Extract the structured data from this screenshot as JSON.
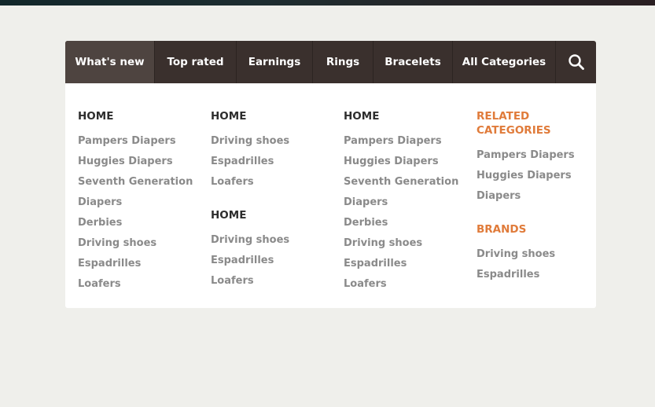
{
  "nav": {
    "items": [
      {
        "label": "What's new"
      },
      {
        "label": "Top rated"
      },
      {
        "label": "Earnings"
      },
      {
        "label": "Rings"
      },
      {
        "label": "Bracelets"
      },
      {
        "label": "All Categories"
      }
    ],
    "search_icon": "search-icon"
  },
  "menu": {
    "col1": {
      "heading": "HOME",
      "links": [
        "Pampers Diapers",
        "Huggies Diapers",
        "Seventh Generation",
        "Diapers",
        "Derbies",
        "Driving shoes",
        "Espadrilles",
        "Loafers"
      ]
    },
    "col2": {
      "heading1": "HOME",
      "links1": [
        "Driving shoes",
        "Espadrilles",
        "Loafers"
      ],
      "heading2": "HOME",
      "links2": [
        "Driving shoes",
        "Espadrilles",
        "Loafers"
      ]
    },
    "col3": {
      "heading": "HOME",
      "links": [
        "Pampers Diapers",
        "Huggies Diapers",
        "Seventh Generation",
        "Diapers",
        "Derbies",
        "Driving shoes",
        "Espadrilles",
        "Loafers"
      ]
    },
    "col4": {
      "heading1_line1": "RELATED",
      "heading1_line2": "CATEGORIES",
      "links1": [
        "Pampers Diapers",
        "Huggies Diapers",
        "Diapers"
      ],
      "heading2": "BRANDS",
      "links2": [
        "Driving shoes",
        "Espadrilles"
      ]
    }
  },
  "colors": {
    "accent": "#e07b3a",
    "nav_bg": "#3a302d",
    "nav_active": "#4e4440"
  }
}
